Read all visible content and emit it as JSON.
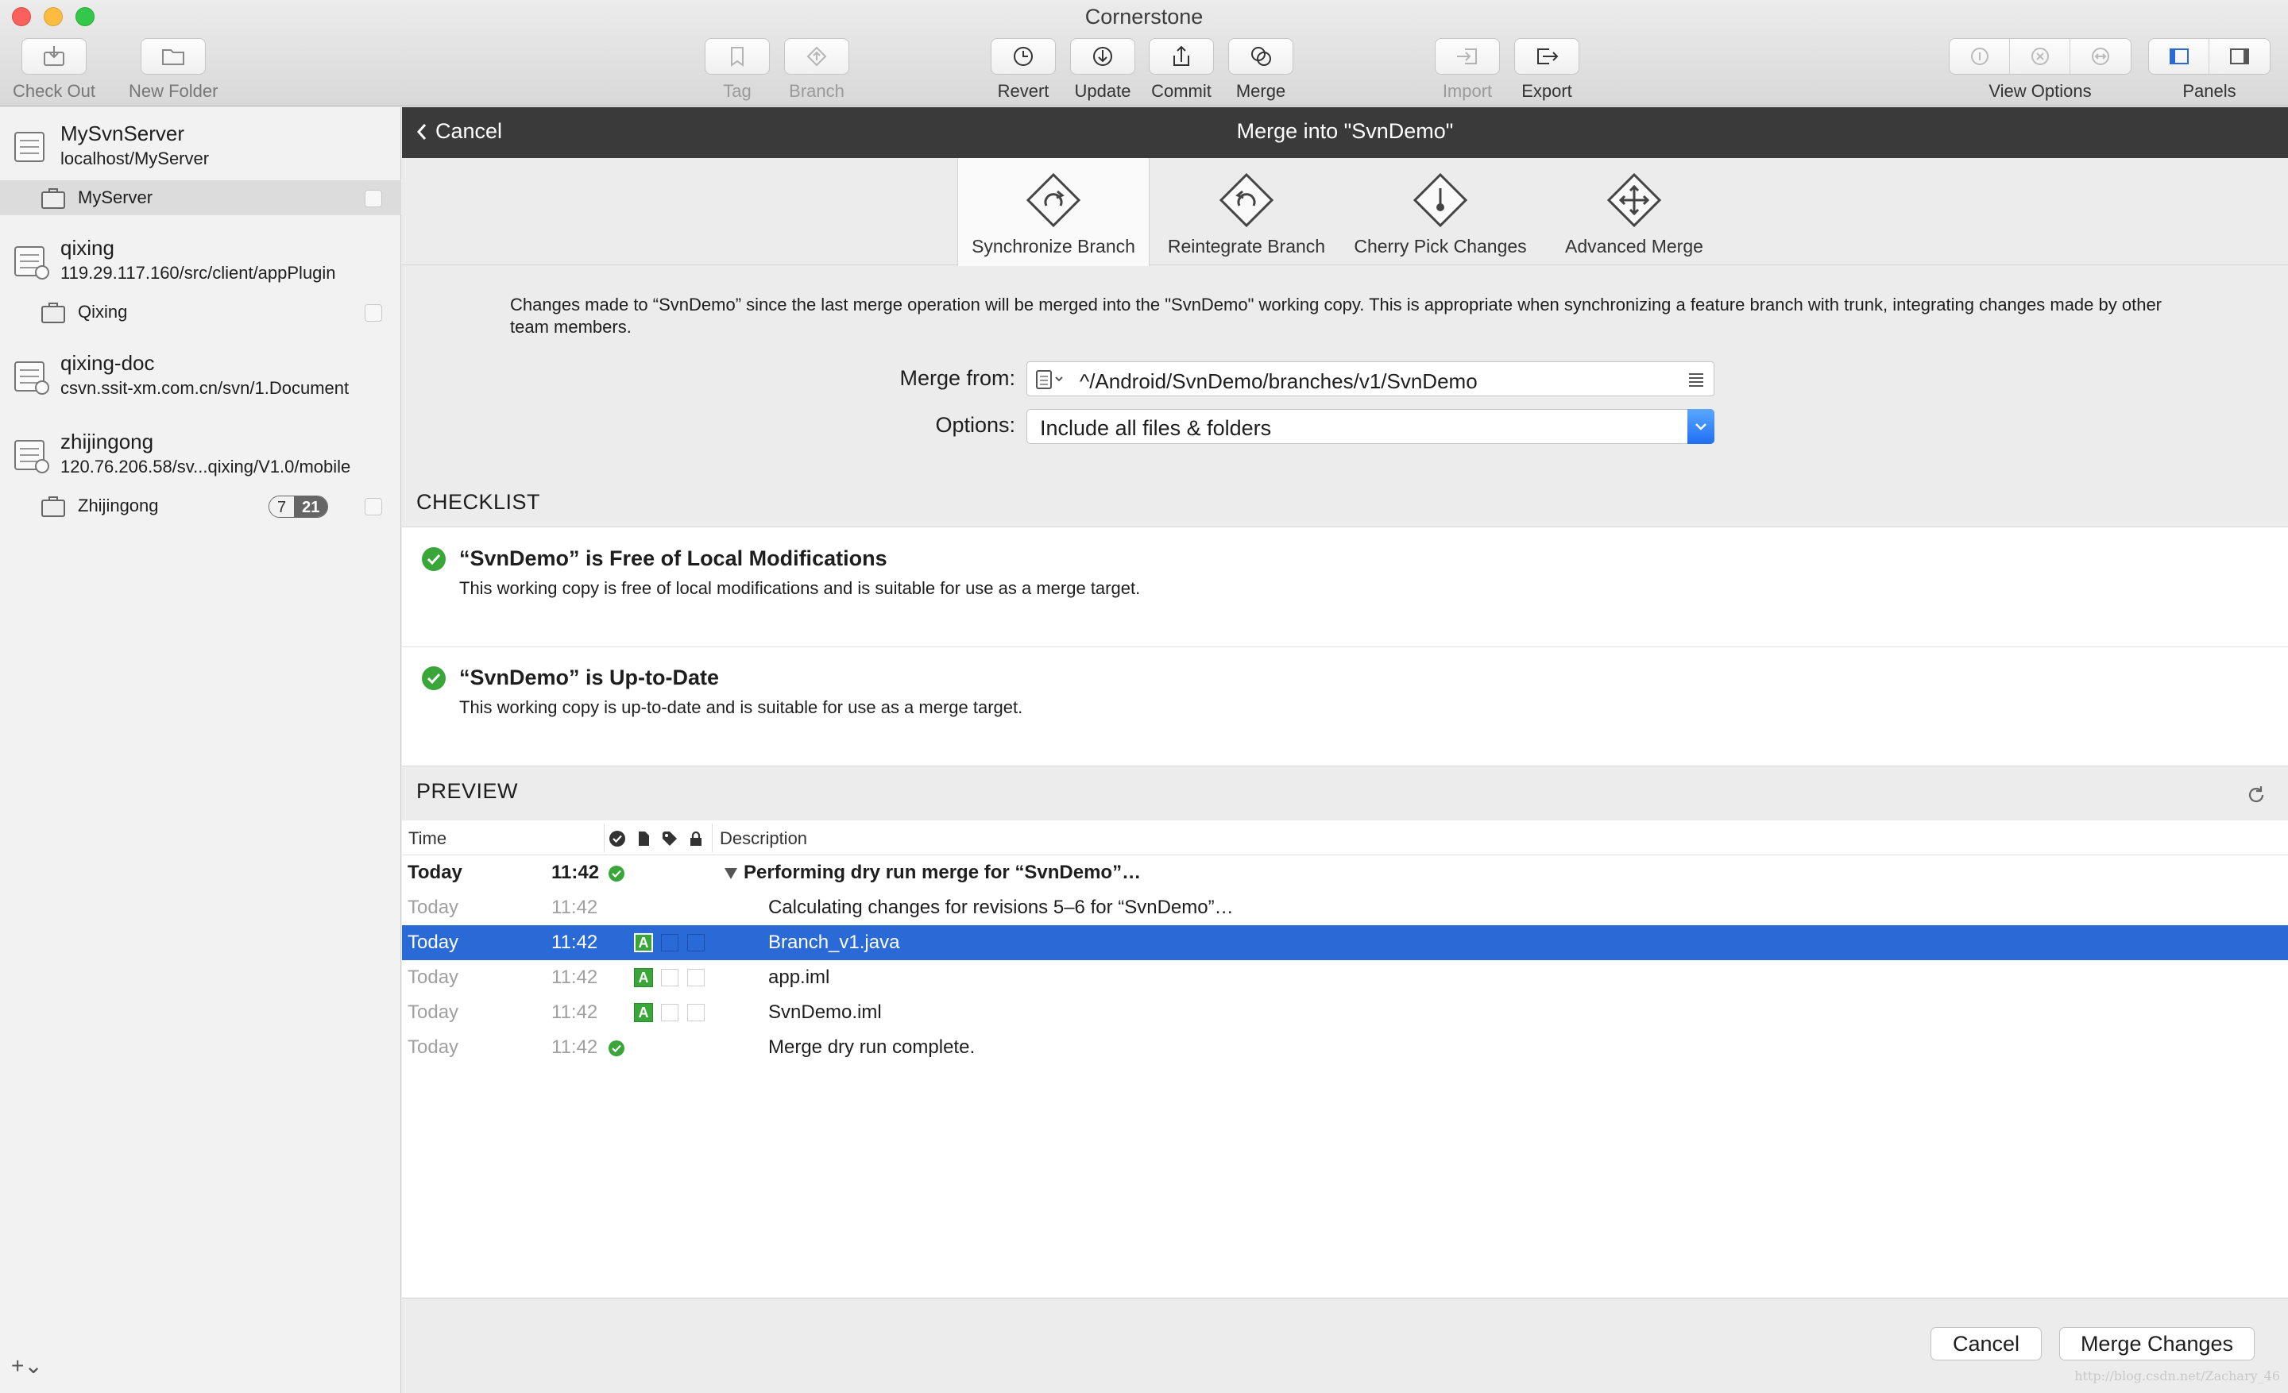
{
  "window": {
    "title": "Cornerstone"
  },
  "toolbar": {
    "check_out": "Check Out",
    "new_folder": "New Folder",
    "tag": "Tag",
    "branch": "Branch",
    "revert": "Revert",
    "update": "Update",
    "commit": "Commit",
    "merge": "Merge",
    "import": "Import",
    "export": "Export",
    "view_options": "View Options",
    "panels": "Panels"
  },
  "sidebar": {
    "repos": [
      {
        "name": "MySvnServer",
        "url": "localhost/MyServer",
        "working_copy": "MyServer"
      },
      {
        "name": "qixing",
        "url": "119.29.117.160/src/client/appPlugin",
        "working_copy": "Qixing"
      },
      {
        "name": "qixing-doc",
        "url": "csvn.ssit-xm.com.cn/svn/1.Document"
      },
      {
        "name": "zhijingong",
        "url": "120.76.206.58/sv...qixing/V1.0/mobile",
        "working_copy": "Zhijingong",
        "badge_modified": "7",
        "badge_total": "21"
      }
    ],
    "add_button": "+⌄"
  },
  "header": {
    "cancel": "Cancel",
    "title": "Merge into \"SvnDemo\""
  },
  "modes": [
    {
      "label": "Synchronize Branch",
      "active": true
    },
    {
      "label": "Reintegrate Branch",
      "active": false
    },
    {
      "label": "Cherry Pick Changes",
      "active": false
    },
    {
      "label": "Advanced Merge",
      "active": false
    }
  ],
  "description": "Changes made to “SvnDemo” since the last merge operation will be merged into the \"SvnDemo\" working copy. This is appropriate when synchronizing a feature branch with trunk, integrating changes made by other team members.",
  "form": {
    "merge_from_label": "Merge from:",
    "merge_from_value": "^/Android/SvnDemo/branches/v1/SvnDemo",
    "options_label": "Options:",
    "options_value": "Include all files & folders"
  },
  "checklist": {
    "title": "CHECKLIST",
    "items": [
      {
        "title": "“SvnDemo” is Free of Local Modifications",
        "desc": "This working copy is free of local modifications and is suitable for use as a merge target."
      },
      {
        "title": "“SvnDemo” is Up-to-Date",
        "desc": "This working copy is up-to-date and is suitable for use as a merge target."
      }
    ]
  },
  "preview": {
    "title": "PREVIEW",
    "col_time": "Time",
    "col_description": "Description",
    "rows": [
      {
        "day": "Today",
        "time": "11:42",
        "desc": "Performing dry run merge for “SvnDemo”…"
      },
      {
        "day": "Today",
        "time": "11:42",
        "desc": "Calculating changes for revisions 5–6 for “SvnDemo”…"
      },
      {
        "day": "Today",
        "time": "11:42",
        "status": "A",
        "desc": "Branch_v1.java"
      },
      {
        "day": "Today",
        "time": "11:42",
        "status": "A",
        "desc": "app.iml"
      },
      {
        "day": "Today",
        "time": "11:42",
        "status": "A",
        "desc": "SvnDemo.iml"
      },
      {
        "day": "Today",
        "time": "11:42",
        "desc": "Merge dry run complete."
      }
    ]
  },
  "footer": {
    "cancel": "Cancel",
    "merge": "Merge Changes",
    "watermark": "http://blog.csdn.net/Zachary_46"
  },
  "colors": {
    "accent": "#2a6ad6",
    "success": "#3aa63a",
    "header_bg": "#3a3a3a"
  }
}
